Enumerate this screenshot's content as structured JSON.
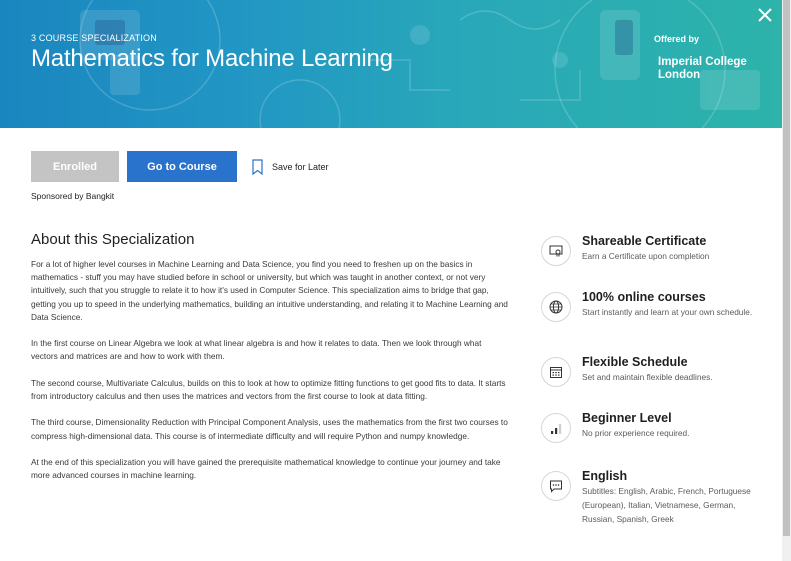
{
  "header": {
    "eyebrow": "3 COURSE SPECIALIZATION",
    "title": "Mathematics for Machine Learning",
    "offered_by_label": "Offered by",
    "partner_line1": "Imperial College",
    "partner_line2": "London",
    "close_icon": "close-icon"
  },
  "actions": {
    "enrolled_label": "Enrolled",
    "go_to_course_label": "Go to Course",
    "save_for_later_label": "Save for Later",
    "sponsored_text": "Sponsored by Bangkit"
  },
  "about": {
    "title": "About this Specialization",
    "paragraphs": [
      "For a lot of higher level courses in Machine Learning and Data Science, you find you need to freshen up on the basics in mathematics - stuff you may have studied before in school or university, but which was taught in another context, or not very intuitively, such that you struggle to relate it to how it's used in Computer Science. This specialization aims to bridge that gap, getting you up to speed in the underlying mathematics, building an intuitive understanding, and relating it to Machine Learning and Data Science.",
      "In the first course on Linear Algebra we look at what linear algebra is and how it relates to data. Then we look through what vectors and matrices are and how to work with them.",
      "The second course, Multivariate Calculus, builds on this to look at how to optimize fitting functions to get good fits to data. It starts from introductory calculus and then uses the matrices and vectors from the first course to look at data fitting.",
      "The third course, Dimensionality Reduction with Principal Component Analysis, uses the mathematics from the first two courses to compress high-dimensional data. This course is of intermediate difficulty and will require Python and numpy knowledge.",
      "At the end of this specialization you will have gained the prerequisite mathematical knowledge to continue your journey and take more advanced courses in machine learning."
    ]
  },
  "features": [
    {
      "icon": "certificate-icon",
      "title": "Shareable Certificate",
      "subtitle": "Earn a Certificate upon completion"
    },
    {
      "icon": "globe-icon",
      "title": "100% online courses",
      "subtitle": "Start instantly and learn at your own schedule."
    },
    {
      "icon": "calendar-icon",
      "title": "Flexible Schedule",
      "subtitle": "Set and maintain flexible deadlines."
    },
    {
      "icon": "level-bars-icon",
      "title": "Beginner Level",
      "subtitle": "No prior experience required."
    },
    {
      "icon": "speech-bubble-icon",
      "title": "English",
      "subtitle": "Subtitles: English, Arabic, French, Portuguese (European), Italian, Vietnamese, German, Russian, Spanish, Greek"
    }
  ],
  "colors": {
    "banner_start": "#1a86bf",
    "banner_end": "#2db3aa",
    "primary_button": "#2a73cc",
    "enrolled_button": "#c4c4c4"
  }
}
